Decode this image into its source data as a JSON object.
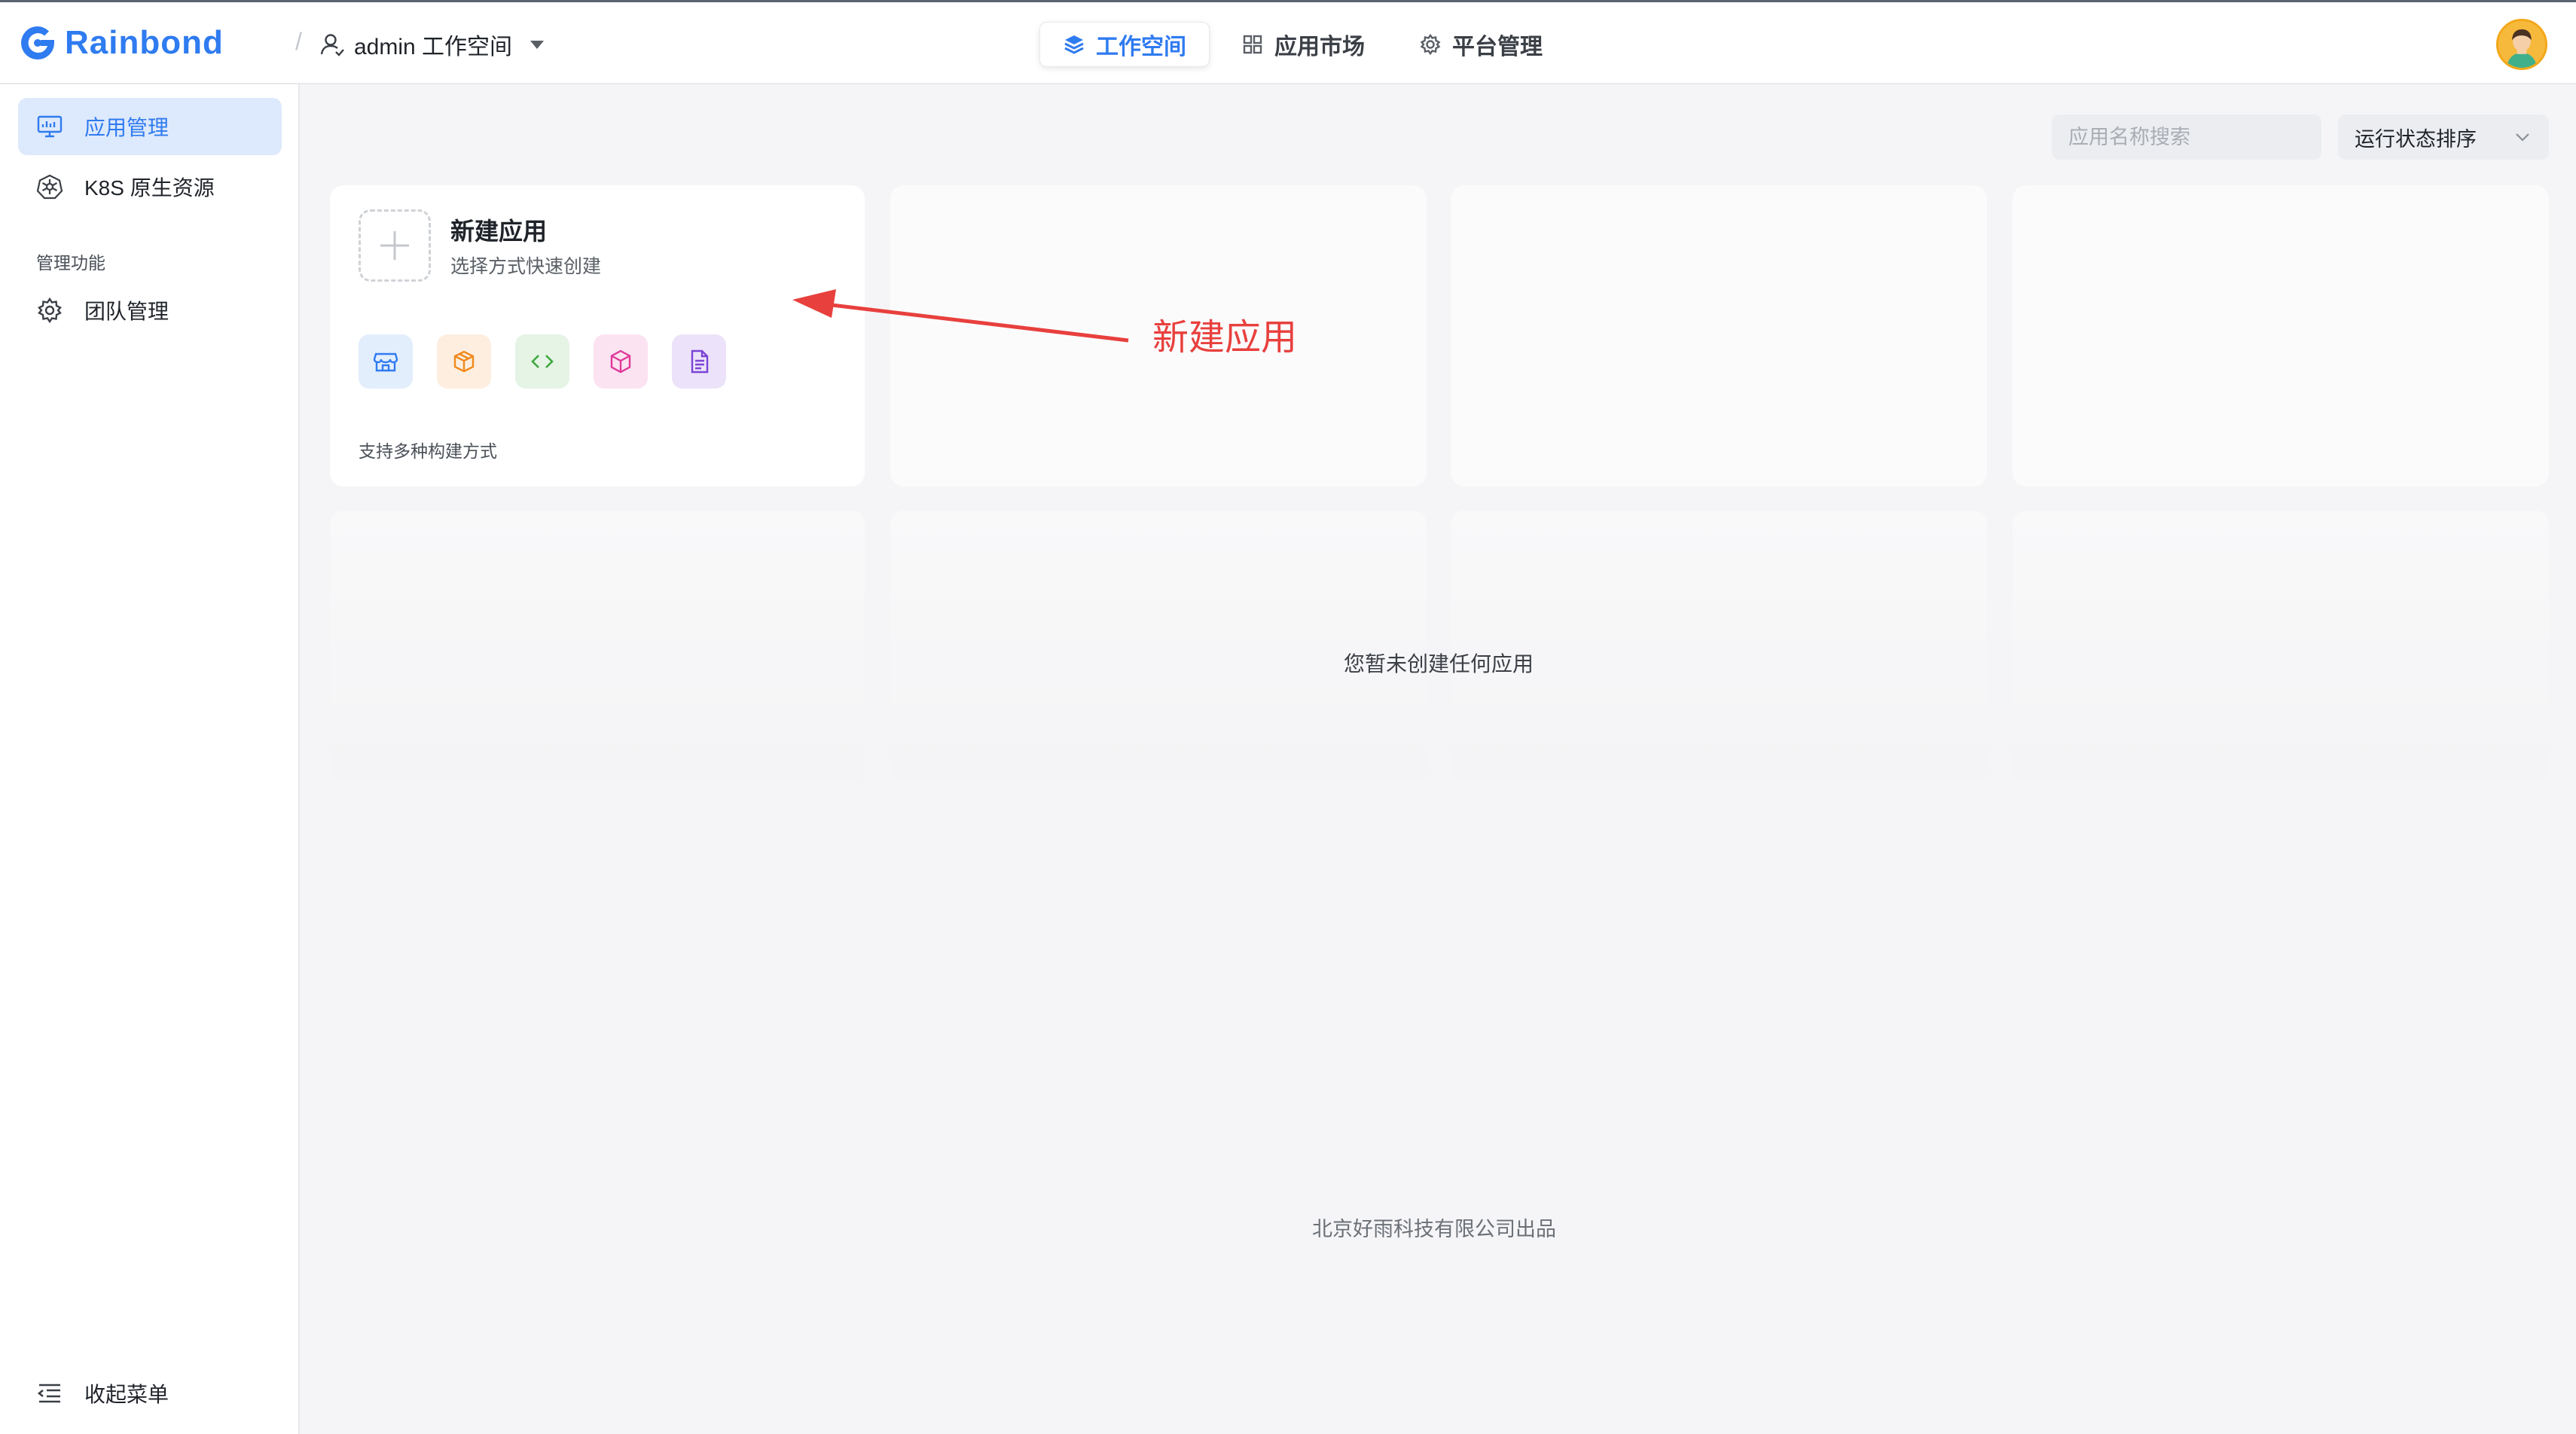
{
  "header": {
    "brand": "Rainbond",
    "breadcrumb_separator": "/",
    "workspace_label": "admin 工作空间",
    "nav": [
      {
        "label": "工作空间",
        "icon": "layers-icon",
        "active": true
      },
      {
        "label": "应用市场",
        "icon": "grid-icon",
        "active": false
      },
      {
        "label": "平台管理",
        "icon": "gear-icon",
        "active": false
      }
    ],
    "accent": "#2f7bf0"
  },
  "sidebar": {
    "items": [
      {
        "label": "应用管理",
        "icon": "monitor-icon",
        "active": true
      },
      {
        "label": "K8S 原生资源",
        "icon": "kubernetes-icon",
        "active": false
      }
    ],
    "section_title": "管理功能",
    "manage_items": [
      {
        "label": "团队管理",
        "icon": "gear-icon"
      }
    ],
    "collapse_label": "收起菜单"
  },
  "toolbar": {
    "search_placeholder": "应用名称搜索",
    "sort_label": "运行状态排序"
  },
  "new_app_card": {
    "title": "新建应用",
    "subtitle": "选择方式快速创建",
    "methods": [
      {
        "icon": "store-icon",
        "color": "#2f7bf0",
        "bg": "#e3eefd"
      },
      {
        "icon": "package-icon",
        "color": "#f08a1c",
        "bg": "#fdeee0"
      },
      {
        "icon": "code-icon",
        "color": "#3fa83f",
        "bg": "#e5f4e5"
      },
      {
        "icon": "cube-icon",
        "color": "#e0399a",
        "bg": "#fbe3f1"
      },
      {
        "icon": "document-icon",
        "color": "#7b44d6",
        "bg": "#ece3fa"
      }
    ],
    "note": "支持多种构建方式"
  },
  "annotation_label": "新建应用",
  "empty_message": "您暂未创建任何应用",
  "footer": "北京好雨科技有限公司出品"
}
